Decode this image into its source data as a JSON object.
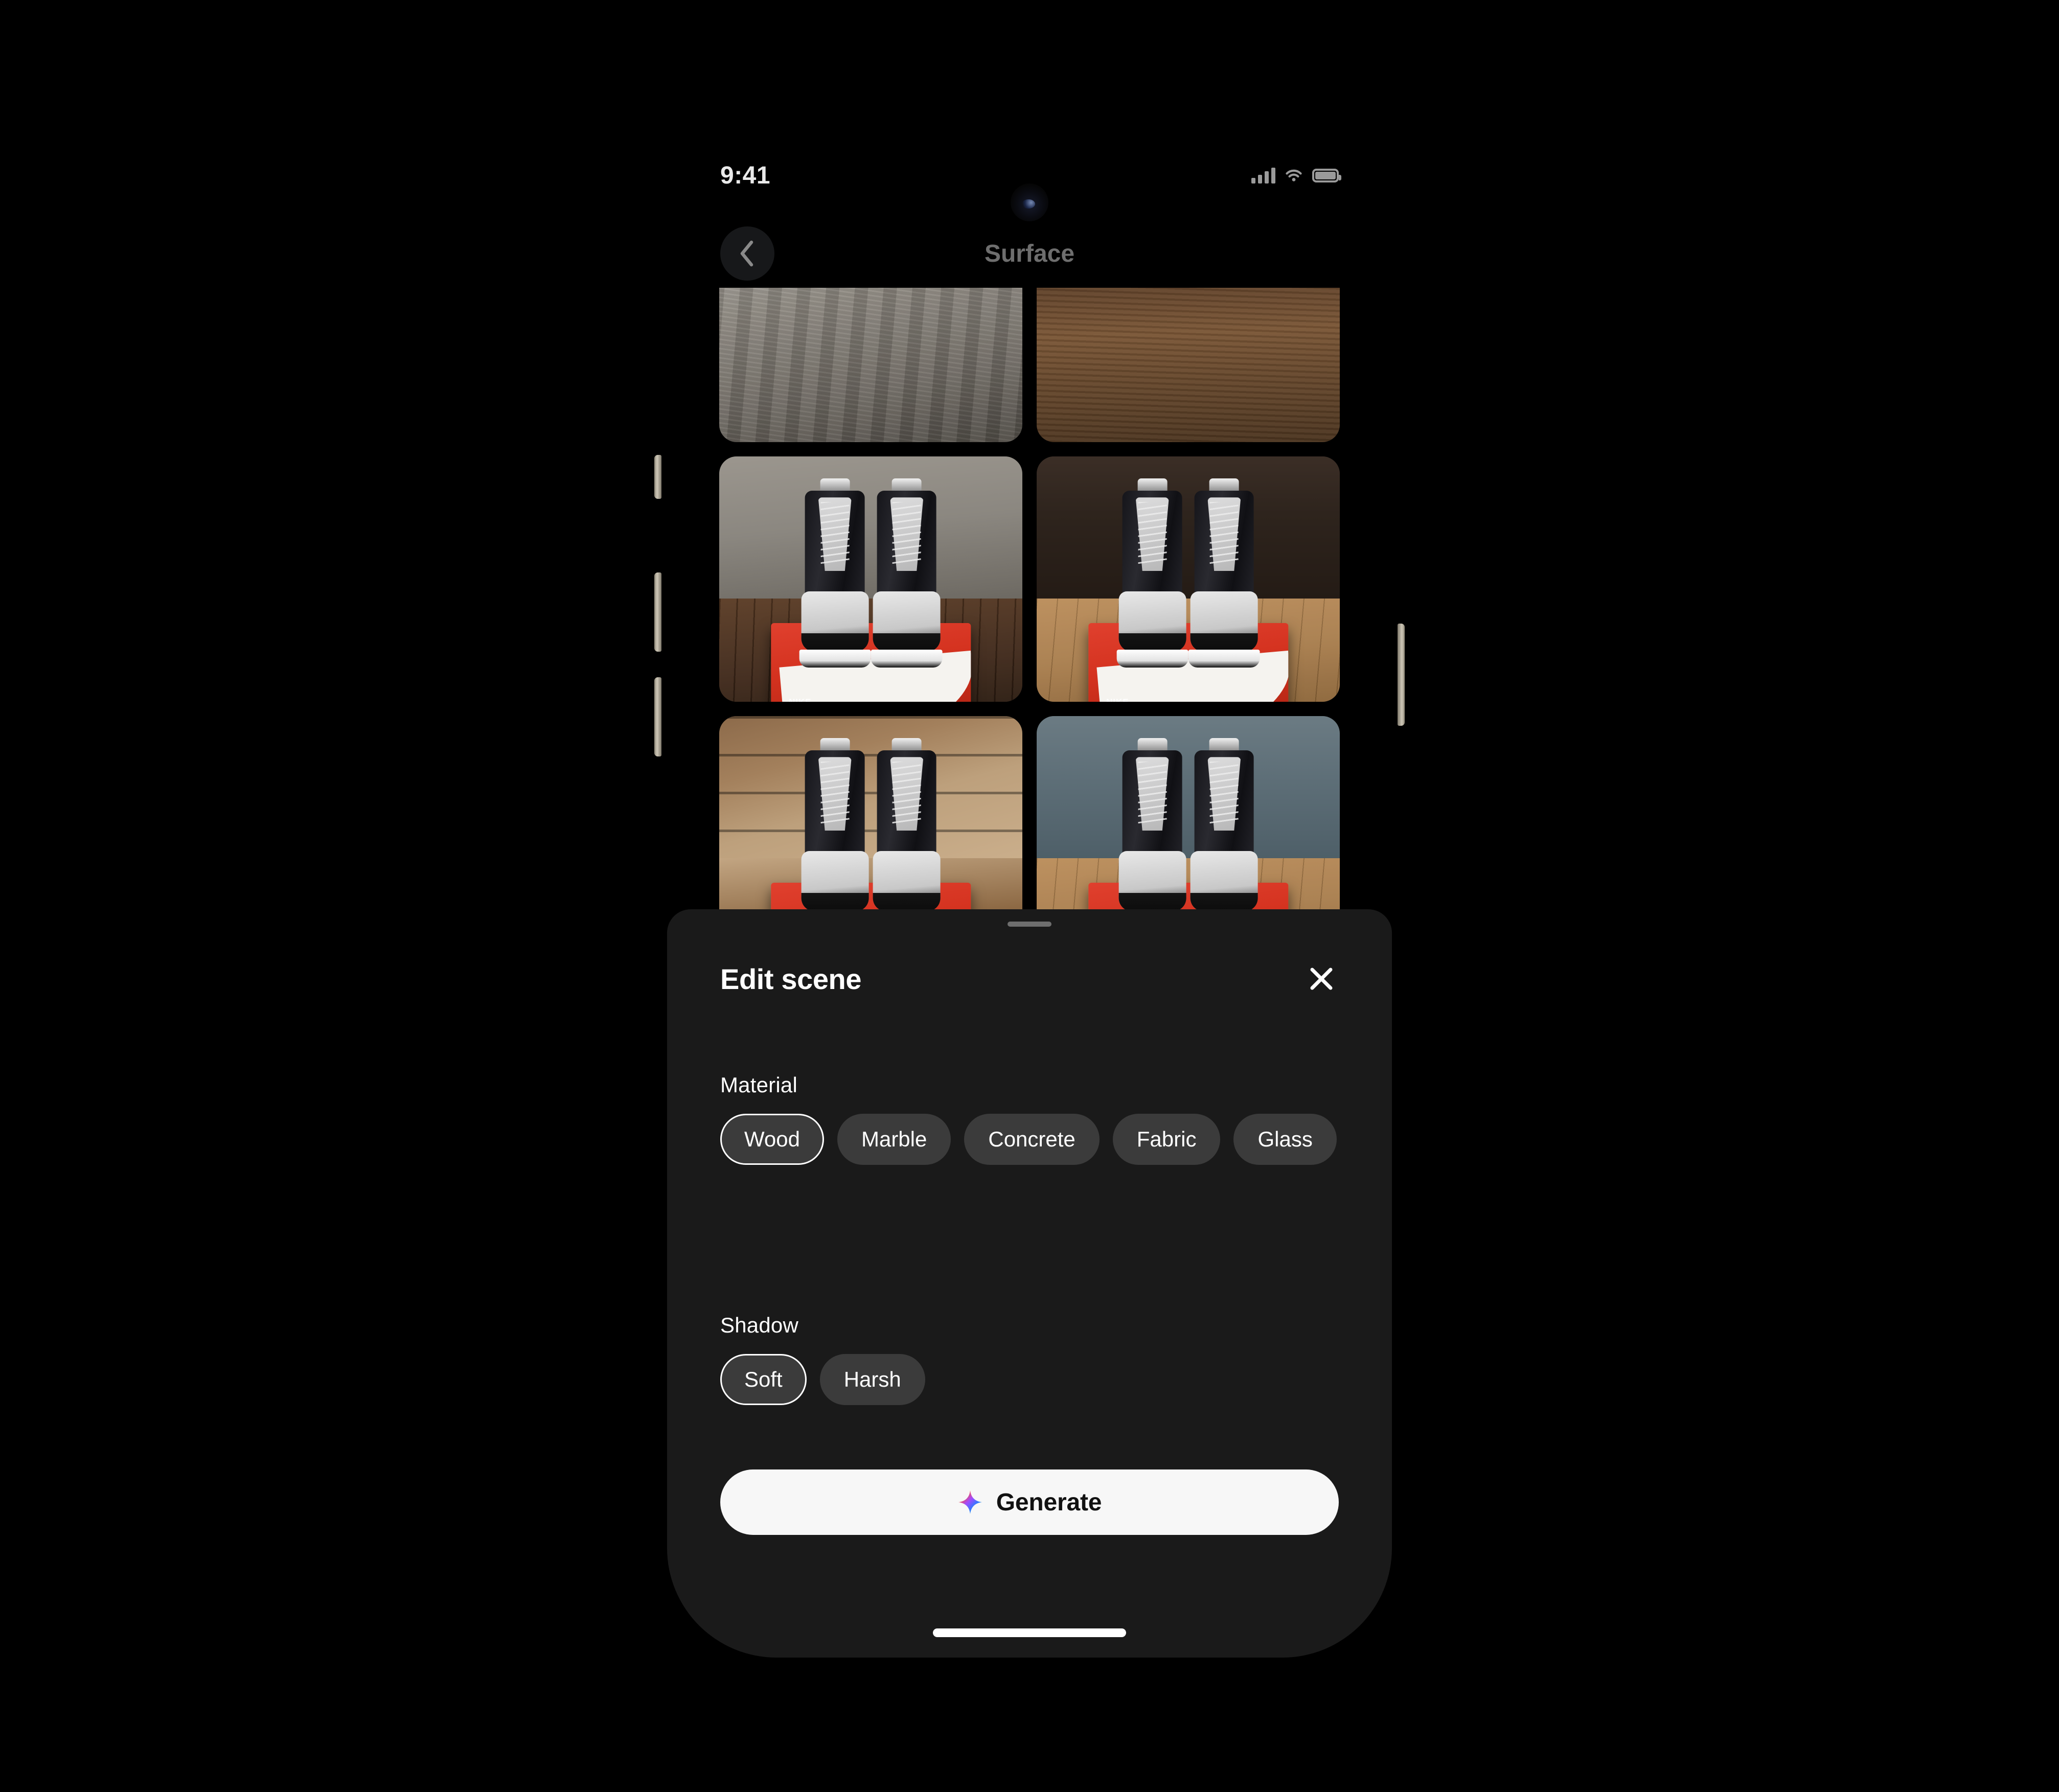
{
  "status_bar": {
    "time": "9:41",
    "cellular_icon": "signal-bars-icon",
    "wifi_icon": "wifi-icon",
    "battery_icon": "battery-icon"
  },
  "nav": {
    "back_icon": "chevron-left-icon",
    "title": "Surface"
  },
  "grid": {
    "tiles": [
      {
        "id": "tile-1",
        "surface": "Grey weathered wood",
        "cropped": true
      },
      {
        "id": "tile-2",
        "surface": "Dark walnut plank",
        "cropped": true
      },
      {
        "id": "tile-3",
        "surface": "Dark wood table",
        "cropped": false
      },
      {
        "id": "tile-4",
        "surface": "Light oak floor",
        "cropped": false
      },
      {
        "id": "tile-5",
        "surface": "Warm wood slats",
        "cropped": false
      },
      {
        "id": "tile-6",
        "surface": "Blue wall with wood floor",
        "cropped": false
      }
    ]
  },
  "sheet": {
    "handle": "drag-handle",
    "title": "Edit scene",
    "close_icon": "close-icon",
    "sections": [
      {
        "label": "Material",
        "options": [
          "Wood",
          "Marble",
          "Concrete",
          "Fabric",
          "Glass"
        ],
        "selected": "Wood"
      },
      {
        "label": "Shadow",
        "options": [
          "Soft",
          "Harsh"
        ],
        "selected": "Soft"
      }
    ],
    "generate": {
      "label": "Generate",
      "icon": "sparkle-icon"
    }
  },
  "colors": {
    "screen_bg": "#000000",
    "sheet_bg": "#1a1a1a",
    "chip_bg": "#3b3b3b",
    "chip_selected_border": "#ffffff",
    "generate_bg": "#f7f7f7",
    "generate_text": "#111111",
    "nav_title": "#6e6e6e",
    "status_icon": "#9a9a9a"
  },
  "home_indicator": "home-indicator"
}
